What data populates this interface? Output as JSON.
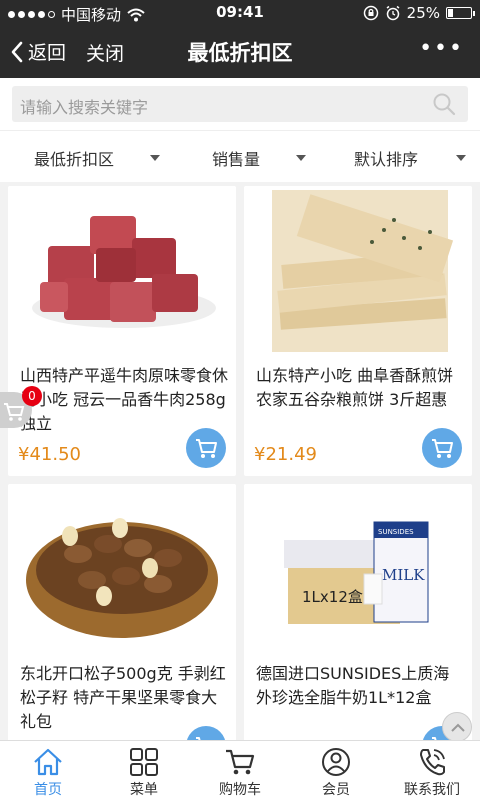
{
  "status_bar": {
    "carrier": "中国移动",
    "time": "09:41",
    "battery": "25%",
    "battery_level": 0.25
  },
  "nav": {
    "back_label": "返回",
    "close_label": "关闭",
    "title": "最低折扣区",
    "more_label": "•••"
  },
  "search": {
    "placeholder": "请输入搜索关键字"
  },
  "filters": [
    {
      "label": "最低折扣区"
    },
    {
      "label": "销售量"
    },
    {
      "label": "默认排序"
    }
  ],
  "products": [
    {
      "name": "山西特产平遥牛肉原味零食休闲小吃 冠云一品香牛肉258g独立",
      "price": "¥41.50"
    },
    {
      "name": "山东特产小吃 曲阜香酥煎饼 农家五谷杂粮煎饼 3斤超惠",
      "price": "¥21.49"
    },
    {
      "name": "东北开口松子500g克 手剥红松子籽 特产干果坚果零食大礼包",
      "price": ""
    },
    {
      "name": "德国进口SUNSIDES上质海外珍选全脂牛奶1L*12盒",
      "price": ""
    }
  ],
  "product_images": {
    "milk_box_text": "1Lx12盒",
    "milk_brand": "SUNSIDES",
    "milk_carton_text": "MILK"
  },
  "cart_badge": "0",
  "tabs": [
    {
      "label": "首页",
      "icon": "home-icon",
      "active": true
    },
    {
      "label": "菜单",
      "icon": "grid-icon",
      "active": false
    },
    {
      "label": "购物车",
      "icon": "cart-icon",
      "active": false
    },
    {
      "label": "会员",
      "icon": "user-icon",
      "active": false
    },
    {
      "label": "联系我们",
      "icon": "phone-icon",
      "active": false
    }
  ],
  "colors": {
    "bar": "#2b2b2b",
    "price": "#e38a1b",
    "cart_button": "#60a8e6",
    "active_tab": "#3a8ee6",
    "badge": "#e60012"
  }
}
